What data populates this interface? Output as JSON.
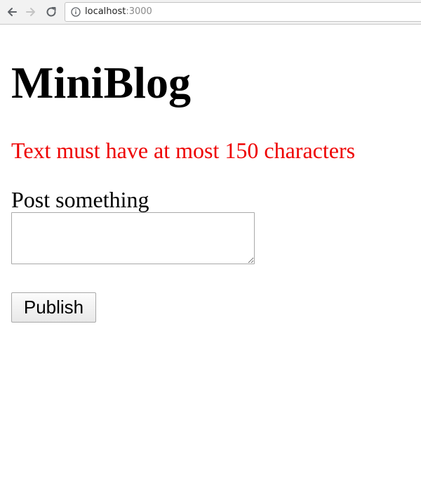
{
  "browser": {
    "url_host": "localhost",
    "url_port": ":3000",
    "back_icon": "arrow-left-icon",
    "forward_icon": "arrow-right-icon",
    "reload_icon": "reload-icon",
    "info_icon": "info-icon"
  },
  "page": {
    "title": "MiniBlog",
    "error": "Text must have at most 150 characters",
    "post_label": "Post something",
    "post_value": "",
    "publish_label": "Publish"
  },
  "colors": {
    "error": "#ee0000",
    "text": "#000000",
    "background": "#ffffff"
  }
}
